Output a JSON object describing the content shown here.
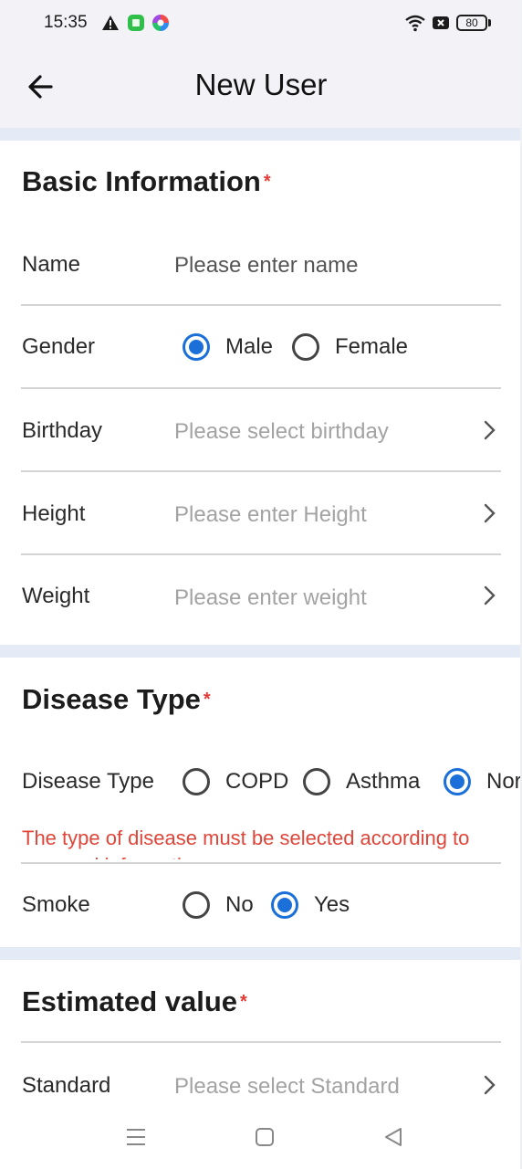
{
  "status_bar": {
    "time": "15:35",
    "battery": "80",
    "icons": [
      "warning-icon",
      "app-icon",
      "pinwheel-icon",
      "wifi-icon",
      "sim-off-icon",
      "battery-icon"
    ]
  },
  "header": {
    "title": "New User",
    "back_icon": "arrow-left-icon"
  },
  "basic": {
    "title": "Basic Information",
    "required": "*",
    "name": {
      "label": "Name",
      "placeholder": "Please enter name"
    },
    "gender": {
      "label": "Gender",
      "options": [
        {
          "label": "Male",
          "selected": true
        },
        {
          "label": "Female",
          "selected": false
        }
      ]
    },
    "birthday": {
      "label": "Birthday",
      "placeholder": "Please select birthday"
    },
    "height": {
      "label": "Height",
      "placeholder": "Please enter Height"
    },
    "weight": {
      "label": "Weight",
      "placeholder": "Please enter weight"
    }
  },
  "disease": {
    "title": "Disease Type",
    "required": "*",
    "type": {
      "label": "Disease Type",
      "options": [
        {
          "label": "COPD",
          "selected": false
        },
        {
          "label": "Asthma",
          "selected": false
        },
        {
          "label": "Nor",
          "selected": true
        }
      ]
    },
    "error": "The type of disease must be selected according to personal information",
    "smoke": {
      "label": "Smoke",
      "options": [
        {
          "label": "No",
          "selected": false
        },
        {
          "label": "Yes",
          "selected": true
        }
      ]
    }
  },
  "estimated": {
    "title": "Estimated value",
    "required": "*",
    "standard": {
      "label": "Standard",
      "placeholder": "Please select Standard"
    }
  },
  "nav": {
    "icons": [
      "menu-icon",
      "home-square-icon",
      "back-triangle-icon"
    ]
  },
  "colors": {
    "accent": "#1a6fd9",
    "error": "#e0453a",
    "header_bg": "#f2f2f7",
    "section_gap": "#e4ebf6"
  }
}
